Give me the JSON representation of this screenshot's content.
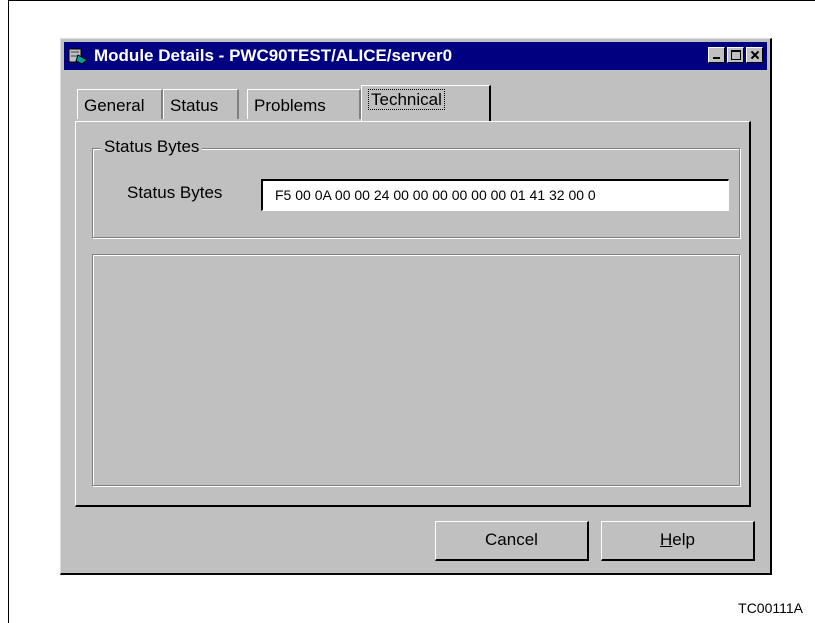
{
  "window": {
    "title": "Module Details - PWC90TEST/ALICE/server0",
    "icon": "module-icon"
  },
  "tabs": [
    {
      "label": "General"
    },
    {
      "label": "Status"
    },
    {
      "label": "Problems"
    },
    {
      "label": "Technical",
      "active": true
    }
  ],
  "status_group": {
    "legend": "Status Bytes",
    "field_label": "Status Bytes",
    "field_value": "F5 00 0A 00 00 24 00 00 00 00 00 00 01  41  32 00 0"
  },
  "buttons": {
    "cancel": "Cancel",
    "help_first": "H",
    "help_rest": "elp"
  },
  "caption": "TC00111A"
}
